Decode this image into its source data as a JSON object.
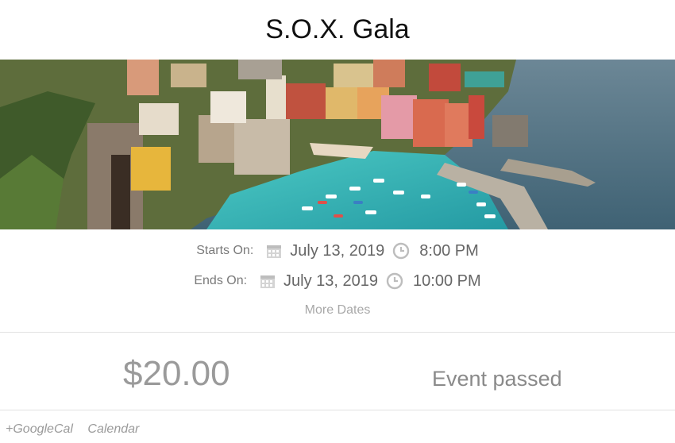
{
  "event": {
    "title": "S.O.X. Gala",
    "hero_image": "coastal-village-harbor-photo",
    "start": {
      "label": "Starts On:",
      "date": "July 13, 2019",
      "time": "8:00 PM"
    },
    "end": {
      "label": "Ends On:",
      "date": "July 13, 2019",
      "time": "10:00 PM"
    },
    "more_dates_label": "More Dates",
    "price": "$20.00",
    "status": "Event passed"
  },
  "footer": {
    "google_cal_label": "+GoogleCal",
    "calendar_label": "Calendar"
  },
  "icons": {
    "date": "calendar-icon",
    "time": "clock-icon"
  },
  "colors": {
    "muted_text": "#8a8a8a",
    "water": "#38b8b6",
    "sea": "#4f7387"
  }
}
